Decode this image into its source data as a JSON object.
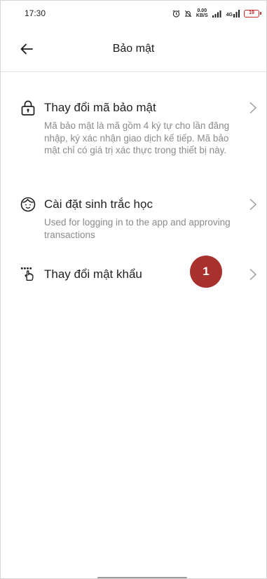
{
  "status_bar": {
    "time": "17:30",
    "net_speed_value": "0.00",
    "net_speed_unit": "KB/S",
    "network_type": "4G",
    "battery_level": "19"
  },
  "header": {
    "title": "Bảo mật"
  },
  "menu": {
    "items": [
      {
        "icon": "lock-icon",
        "title": "Thay đổi mã bảo mật",
        "description": "Mã bảo mật là mã gồm 4 ký tự cho lần đăng nhập, ký xác nhận giao dịch kế tiếp. Mã bảo mật chỉ có giá trị xác thực trong thiết bị này."
      },
      {
        "icon": "face-icon",
        "title": "Cài đặt sinh trắc học",
        "description": "Used for logging in to the app and approving transactions"
      },
      {
        "icon": "password-touch-icon",
        "title": "Thay đổi mật khẩu",
        "description": ""
      }
    ]
  },
  "annotation": {
    "step_number": "1",
    "badge_color": "#a8312d"
  }
}
